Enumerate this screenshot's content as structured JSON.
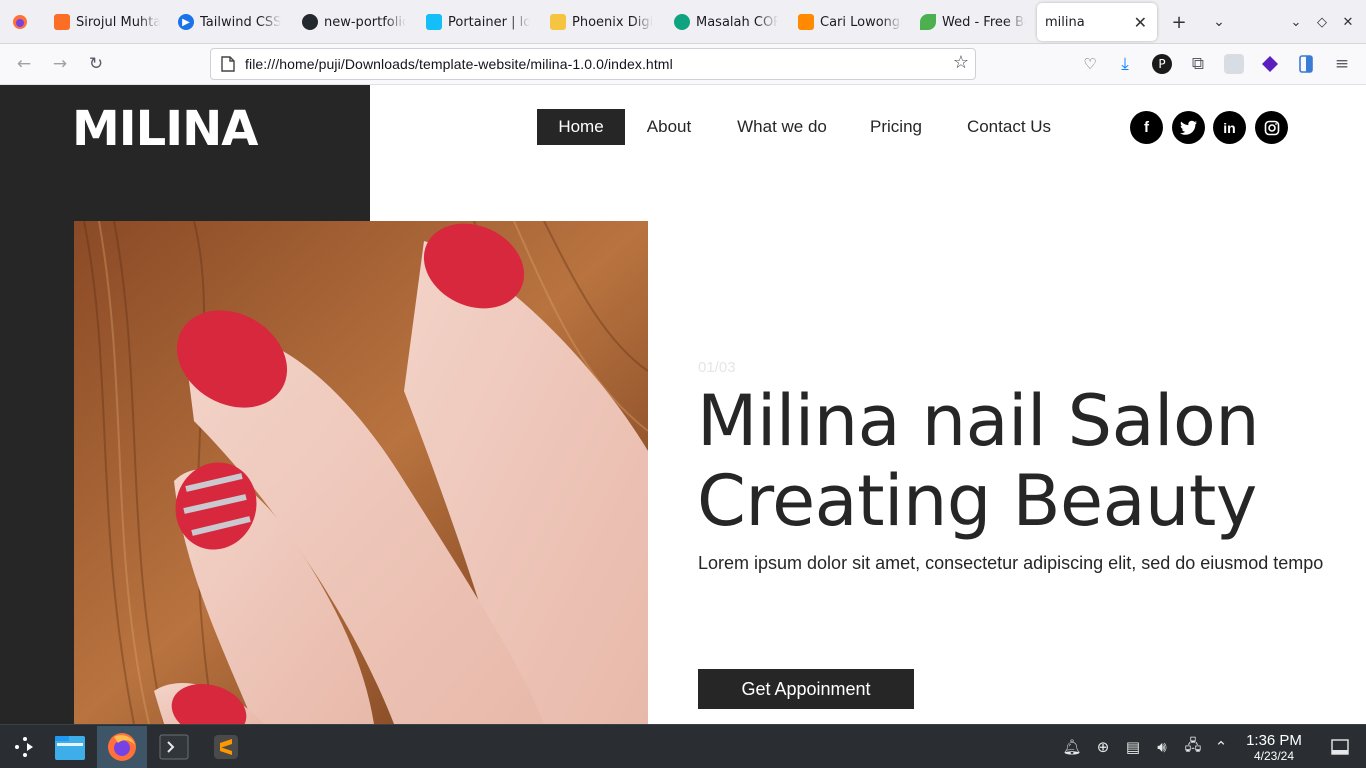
{
  "browser": {
    "tabs": [
      {
        "title": "Sirojul Muhta",
        "icon": "gitlab-icon"
      },
      {
        "title": "Tailwind CSS",
        "icon": "tailwind-icon"
      },
      {
        "title": "new-portfolio",
        "icon": "github-icon"
      },
      {
        "title": "Portainer | lo",
        "icon": "portainer-icon"
      },
      {
        "title": "Phoenix Digi",
        "icon": "phoenix-icon"
      },
      {
        "title": "Masalah COR",
        "icon": "chatgpt-icon"
      },
      {
        "title": "Cari Lowonga",
        "icon": "job-icon"
      },
      {
        "title": "Wed - Free Bo",
        "icon": "leaf-icon"
      },
      {
        "title": "milina",
        "icon": ""
      }
    ],
    "active_tab": 8,
    "url": "file:///home/puji/Downloads/template-website/milina-1.0.0/index.html"
  },
  "site": {
    "logo": "MILINA",
    "nav": [
      "Home",
      "About",
      "What we do",
      "Pricing",
      "Contact Us"
    ],
    "active_nav": "Home",
    "social": [
      "f",
      "t",
      "in",
      "ig"
    ],
    "counter": "01/03",
    "headline_line1": "Milina nail Salon",
    "headline_line2": "Creating Beauty",
    "lead": "Lorem ipsum dolor sit amet, consectetur adipiscing elit, sed do eiusmod tempo",
    "cta": "Get Appoinment"
  },
  "taskbar": {
    "time": "1:36 PM",
    "date": "4/23/24"
  },
  "colors": {
    "dark": "#262626",
    "nail_red": "#d8283e"
  }
}
